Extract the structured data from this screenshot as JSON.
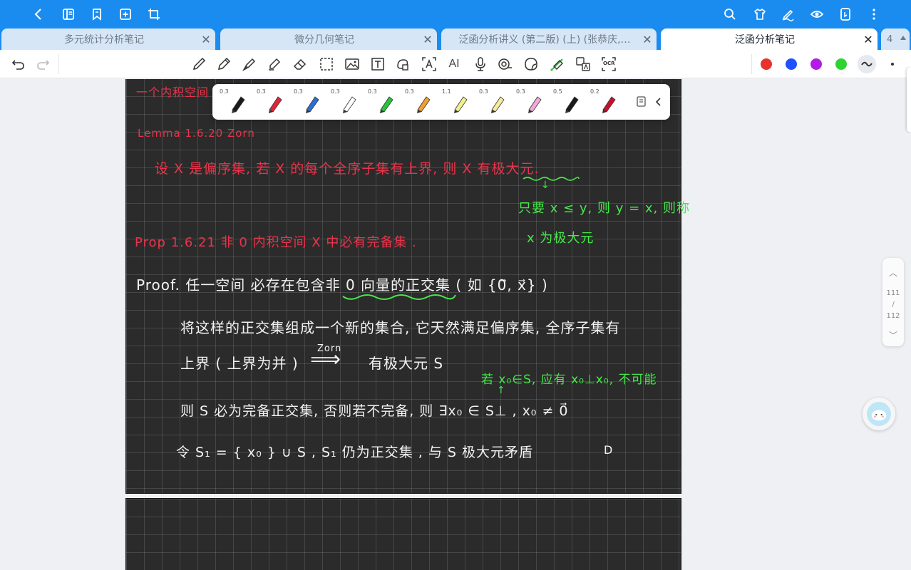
{
  "topbar": {
    "icons": [
      "back-icon",
      "sidebar-icon",
      "bookmark-icon",
      "add-page-icon",
      "crop-icon",
      "search-icon",
      "theme-icon",
      "pen-settings-icon",
      "view-icon",
      "device-icon",
      "more-icon"
    ]
  },
  "tabs": [
    {
      "title": "多元统计分析笔记",
      "close": "✕"
    },
    {
      "title": "微分几何笔记",
      "close": "✕"
    },
    {
      "title": "泛函分析讲义 (第二版) (上) (张恭庆,…",
      "close": "✕"
    },
    {
      "title": "泛函分析笔记",
      "close": "✕",
      "active": true
    }
  ],
  "tab_count": "4",
  "toolbar": {
    "tools": [
      "undo-icon",
      "redo-icon",
      "pen-icon",
      "pencil-icon",
      "fountain-pen-icon",
      "highlighter-icon",
      "eraser-icon",
      "lasso-icon",
      "image-icon",
      "text-box-icon",
      "shape-icon",
      "ocr-text-icon",
      "ai-icon",
      "microphone-icon",
      "tape-icon",
      "sticker-icon",
      "laser-pointer-icon",
      "translate-icon",
      "ocr-icon"
    ],
    "ai_label": "AI",
    "ocr_label": "OCR",
    "colors": [
      "#e8322d",
      "#1f4fff",
      "#b21de6",
      "#2fd32f"
    ]
  },
  "pen_picker": {
    "pens": [
      {
        "size": "0.3",
        "color": "#1a1a1a"
      },
      {
        "size": "0.3",
        "color": "#e0243a"
      },
      {
        "size": "0.3",
        "color": "#2a6fd6"
      },
      {
        "size": "0.3",
        "color": "#ffffff"
      },
      {
        "size": "0.3",
        "color": "#25c53a"
      },
      {
        "size": "0.3",
        "color": "#f0a030"
      },
      {
        "size": "1.1",
        "color": "#f4f08a"
      },
      {
        "size": "0.3",
        "color": "#f6ec9a"
      },
      {
        "size": "0.3",
        "color": "#f2a8d8"
      },
      {
        "size": "0.5",
        "color": "#1a1a1a"
      },
      {
        "size": "0.2",
        "color": "#c8102e"
      }
    ]
  },
  "note": {
    "line_top": "一个内积空间 ……",
    "lemma_title": "Lemma  1.6.20     Zorn",
    "lemma_body": "设 X 是偏序集, 若 X 的每个全序子集有上界, 则 X 有极大元.",
    "arrow_down": "↓",
    "green_note1": "只要 x ≤ y, 则 y = x, 则称",
    "green_note2": "x 为极大元",
    "prop": "Prop 1.6.21    非 0 内积空间 X 中必有完备集 .",
    "proof1": "Proof.  任一空间  必存在包含非 0 向量的正交集  ( 如 {0⃗, x⃗} )",
    "proof2": "将这样的正交集组成一个新的集合, 它天然满足偏序集, 全序子集有",
    "proof3a": "上界 ( 上界为并 )",
    "zorn_label": "Zorn",
    "zorn_arrow": "⟹",
    "proof3b": "有极大元 S",
    "green_note3": "若 x₀∈S, 应有 x₀⊥x₀, 不可能",
    "up_arrow": "↑",
    "proof4": "则 S 必为完备正交集,  否则若不完备,  则 ∃x₀ ∈ S⊥ ,  x₀ ≠ 0⃗",
    "proof5": "令 S₁ = { x₀ } ∪ S ,    S₁ 仍为正交集 ,   与 S 极大元矛盾",
    "qed": "D"
  },
  "page_nav": {
    "current": "111",
    "sep": "/",
    "total": "112",
    "up": "︿",
    "down": "﹀"
  }
}
